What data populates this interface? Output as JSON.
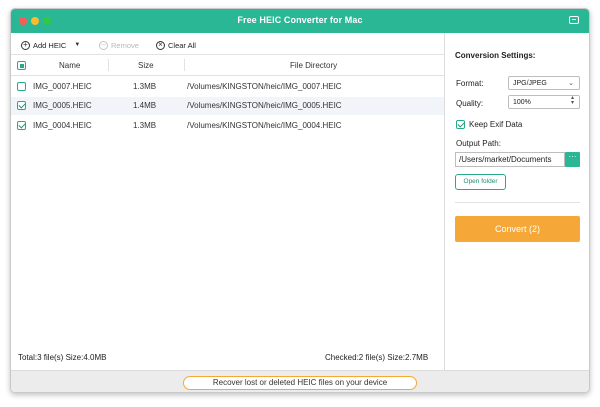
{
  "window": {
    "title": "Free HEIC Converter for Mac"
  },
  "colors": {
    "accent": "#29b796",
    "convert": "#f5a838"
  },
  "toolbar": {
    "add_label": "Add HEIC",
    "remove_label": "Remove",
    "clear_label": "Clear All"
  },
  "table": {
    "headers": {
      "name": "Name",
      "size": "Size",
      "dir": "File Directory"
    },
    "rows": [
      {
        "checked": false,
        "name": "IMG_0007.HEIC",
        "size": "1.3MB",
        "dir": "/Volumes/KINGSTON/heic/IMG_0007.HEIC"
      },
      {
        "checked": true,
        "name": "IMG_0005.HEIC",
        "size": "1.4MB",
        "dir": "/Volumes/KINGSTON/heic/IMG_0005.HEIC"
      },
      {
        "checked": true,
        "name": "IMG_0004.HEIC",
        "size": "1.3MB",
        "dir": "/Volumes/KINGSTON/heic/IMG_0004.HEIC"
      }
    ]
  },
  "status": {
    "total": "Total:3 file(s) Size:4.0MB",
    "checked": "Checked:2 file(s) Size:2.7MB"
  },
  "settings": {
    "title": "Conversion Settings:",
    "format_label": "Format:",
    "format_value": "JPG/JPEG",
    "quality_label": "Quality:",
    "quality_value": "100%",
    "keep_exif_label": "Keep Exif Data",
    "output_path_label": "Output Path:",
    "output_path_value": "/Users/market/Documents",
    "browse_label": "···",
    "open_folder_label": "Open folder",
    "convert_label": "Convert (2)"
  },
  "bottom": {
    "recover_label": "Recover lost or deleted HEIC files on your device"
  }
}
